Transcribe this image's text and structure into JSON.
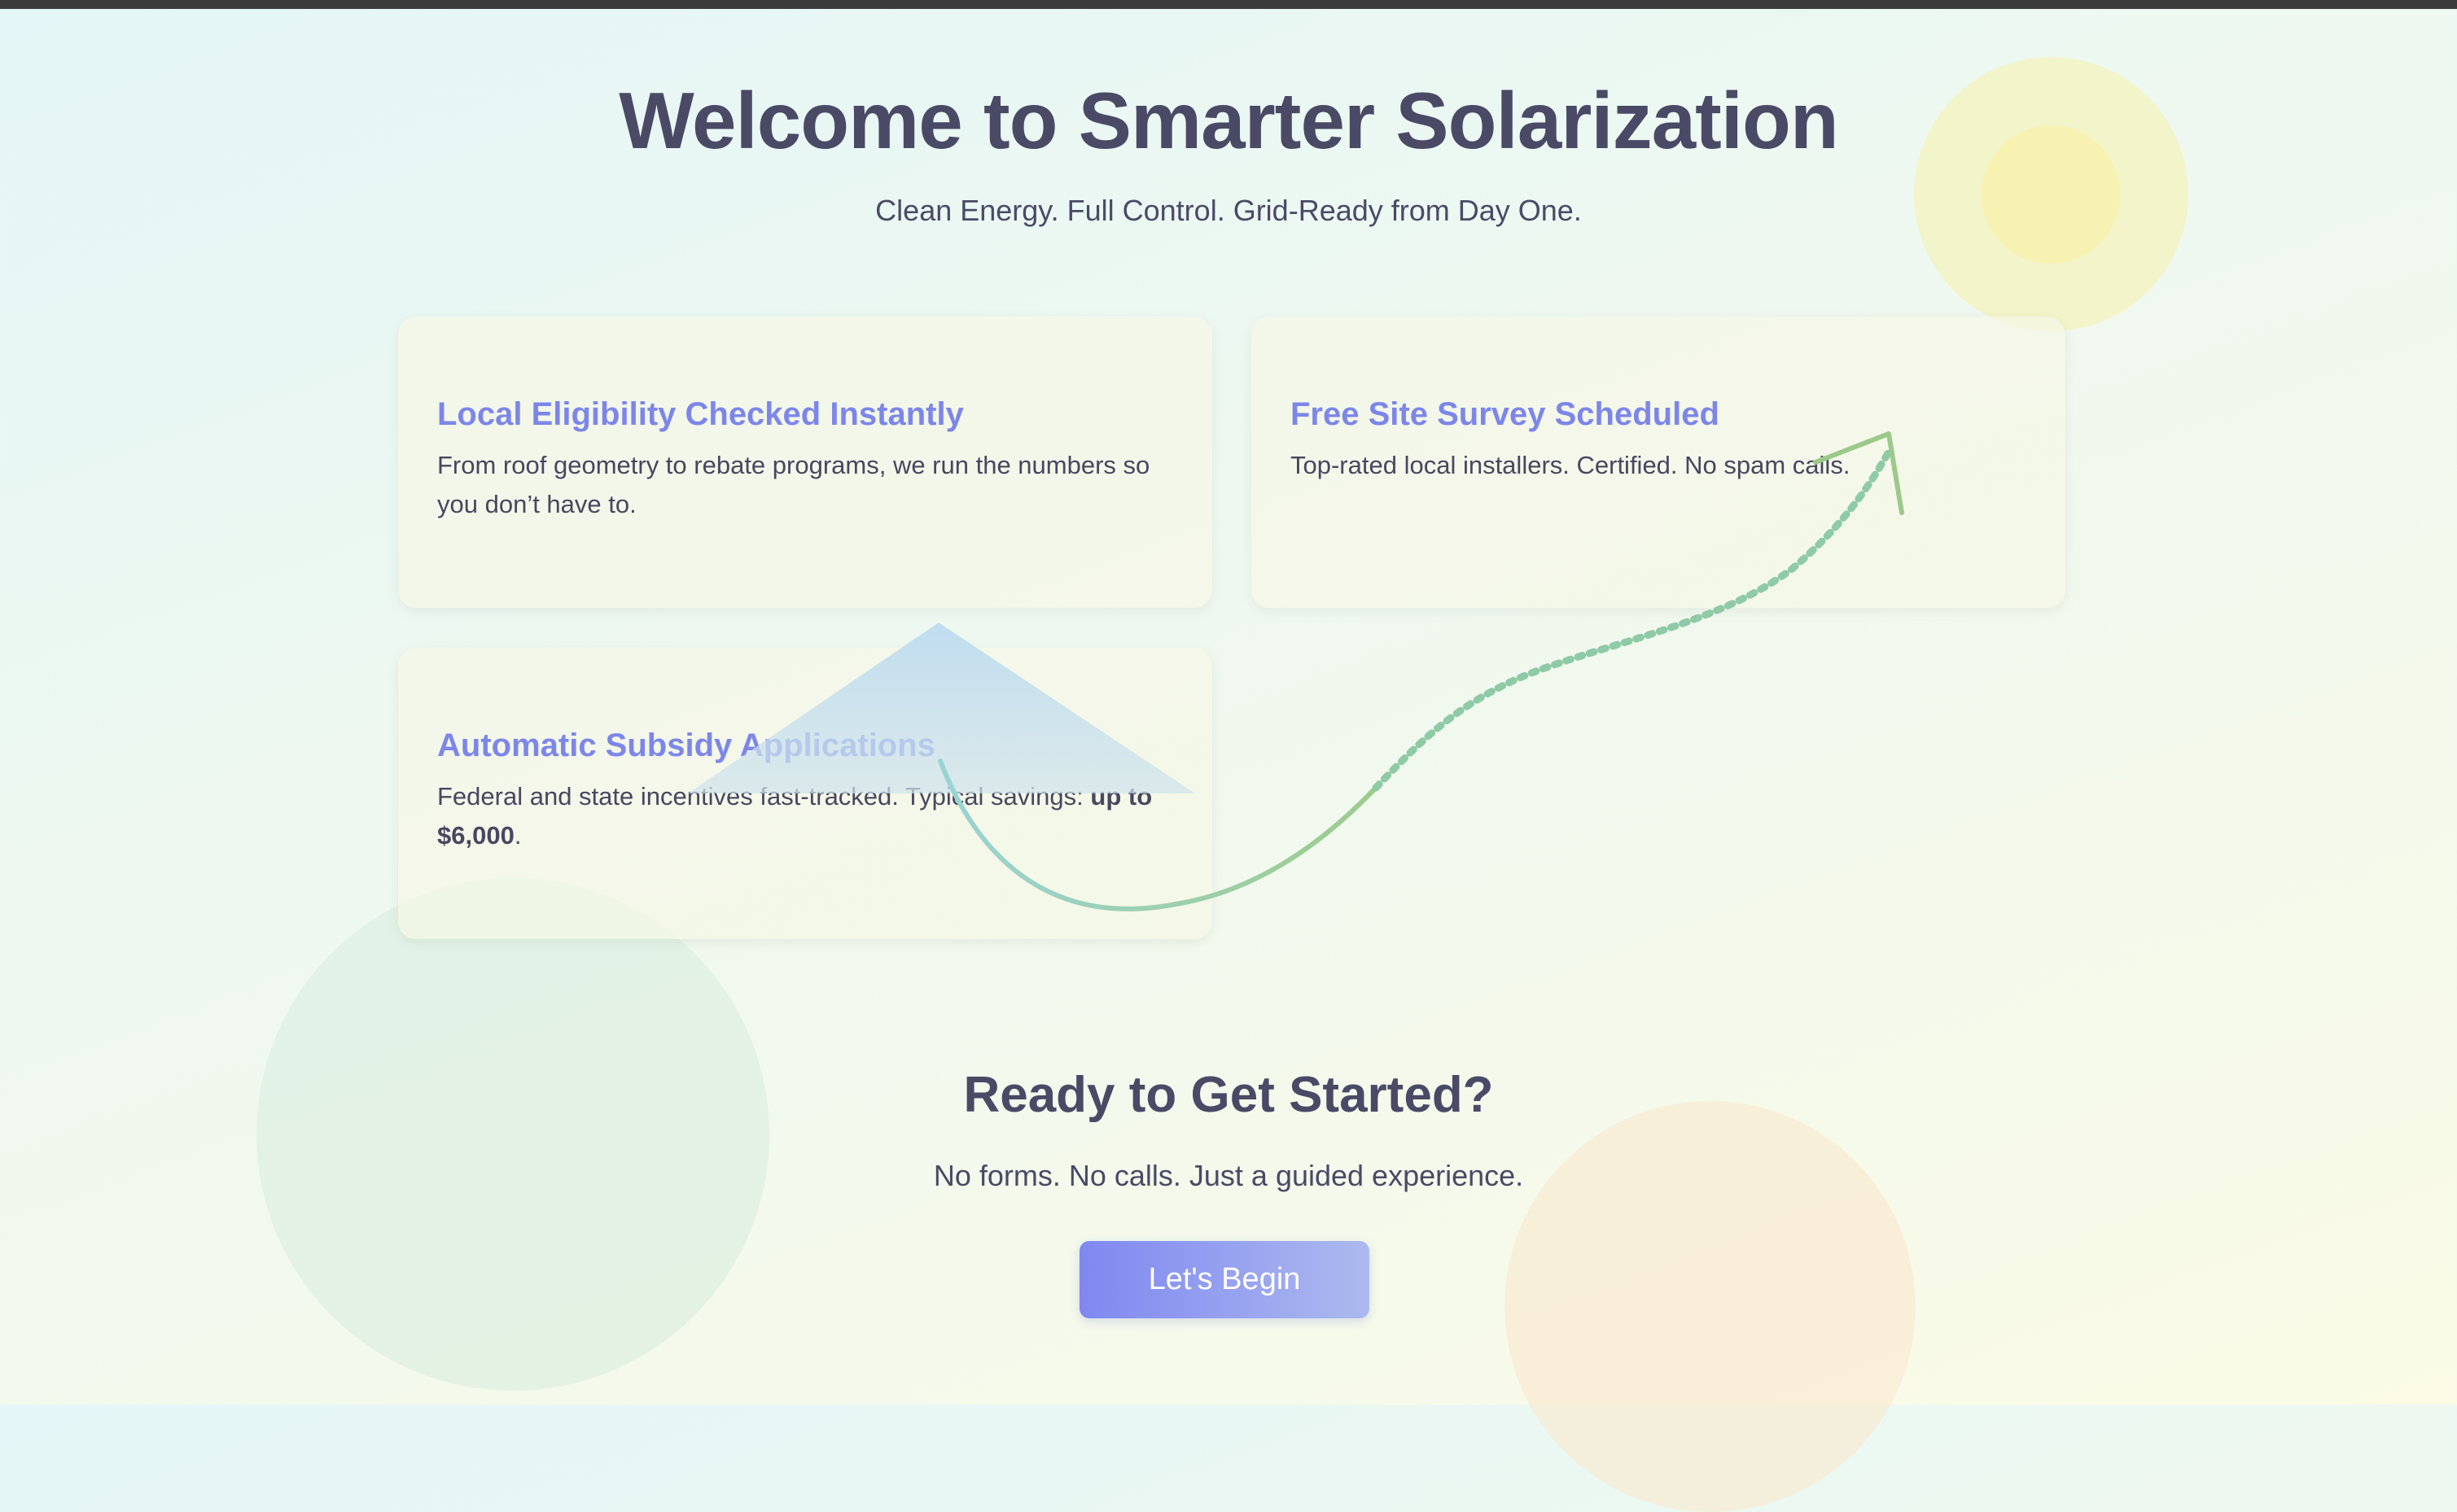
{
  "hero": {
    "title": "Welcome to Smarter Solarization",
    "subtitle": "Clean Energy. Full Control. Grid-Ready from Day One."
  },
  "features": [
    {
      "title": "Local Eligibility Checked Instantly",
      "description": "From roof geometry to rebate programs, we run the numbers so you don’t have to."
    },
    {
      "title": "Free Site Survey Scheduled",
      "description": "Top-rated local installers. Certified. No spam calls."
    },
    {
      "title": "Automatic Subsidy Applications",
      "description_prefix": "Federal and state incentives fast-tracked. Typical savings: ",
      "description_highlight": "up to $6,000",
      "description_suffix": "."
    }
  ],
  "cta": {
    "title": "Ready to Get Started?",
    "subtitle": "No forms. No calls. Just a guided experience.",
    "button_label": "Let's Begin"
  },
  "colors": {
    "accent": "#7c86ea",
    "text": "#4a4a66",
    "button_gradient_start": "#7f88f0",
    "button_gradient_end": "#adb9ef",
    "sun": "#f6f0aa",
    "top_bar": "#3b3b3b"
  },
  "decorations": [
    "sun-icon",
    "growth-arrow-icon",
    "triangle-shape",
    "green-circle",
    "orange-circle"
  ]
}
